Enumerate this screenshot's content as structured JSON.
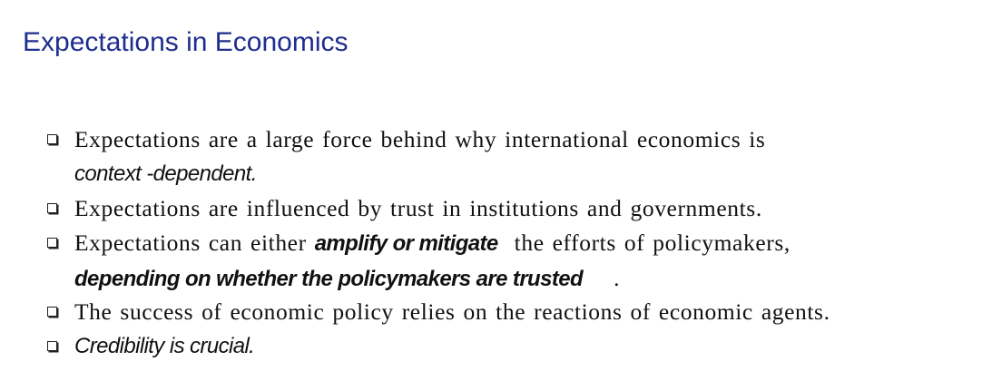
{
  "slide": {
    "title": "Expectations in Economics",
    "bullets": [
      {
        "line1": "Expectations are a large force behind why international economics is",
        "line2_em": "context -dependent."
      },
      {
        "text": "Expectations are influenced by trust in institutions and governments."
      },
      {
        "pre": "Expectations can either",
        "em": "amplify or mitigate",
        "post": "the efforts of policymakers,",
        "line2_em": "depending on whether the policymakers are trusted",
        "line2_end": "."
      },
      {
        "text": "The success of economic policy relies on the reactions of economic agents."
      },
      {
        "em": "Credibility is crucial."
      }
    ]
  }
}
